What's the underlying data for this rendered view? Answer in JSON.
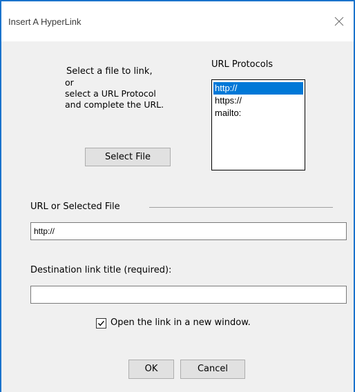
{
  "window": {
    "title": "Insert A HyperLink",
    "close_glyph": "✕"
  },
  "instructions": {
    "line1": "Select a file to link,",
    "line2": "or",
    "line3": "select a URL Protocol",
    "line4": "and complete the URL."
  },
  "protocols": {
    "label": "URL Protocols",
    "items": [
      "http://",
      "https://",
      "mailto:"
    ],
    "selected": "http://"
  },
  "buttons": {
    "select_file": "Select File",
    "ok": "OK",
    "cancel": "Cancel"
  },
  "url_field": {
    "label": "URL or Selected File",
    "value": "http://"
  },
  "destination_field": {
    "label": "Destination link title (required):",
    "value": ""
  },
  "new_window": {
    "label": "Open the link in a new window.",
    "checked": true
  },
  "colors": {
    "window_border": "#1a73cc",
    "selection": "#0078d7",
    "dialog_bg": "#f0f0f0"
  }
}
